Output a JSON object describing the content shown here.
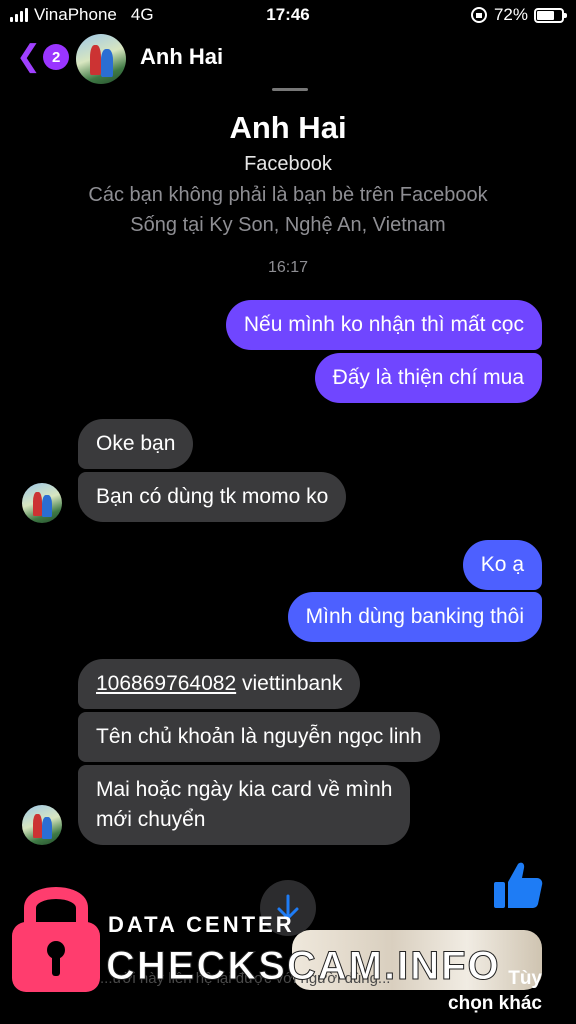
{
  "status_bar": {
    "carrier": "VinaPhone",
    "network": "4G",
    "time": "17:46",
    "battery": "72%",
    "battery_level": 0.72
  },
  "header": {
    "unread_count": "2",
    "contact_name": "Anh Hai"
  },
  "profile": {
    "name": "Anh Hai",
    "source": "Facebook",
    "note": "Các bạn không phải là bạn bè trên Facebook",
    "location": "Sống tại Ky Son, Nghệ An, Vietnam",
    "timestamp": "16:17"
  },
  "messages": [
    {
      "side": "out",
      "text": "Nếu mình ko nhận thì mất cọc"
    },
    {
      "side": "out",
      "text": "Đấy là thiện chí mua"
    },
    {
      "side": "in",
      "text": "Oke bạn"
    },
    {
      "side": "in",
      "text": "Bạn có dùng tk momo ko"
    },
    {
      "side": "out",
      "text": "Ko ạ"
    },
    {
      "side": "out",
      "text": "Mình dùng banking thôi"
    },
    {
      "side": "in",
      "account_number": "106869764082",
      "text": " viettinbank"
    },
    {
      "side": "in",
      "text": "Tên chủ khoản là nguyễn ngọc linh"
    },
    {
      "side": "in",
      "line1": "Mai hoặc ngày kia card về mình",
      "line2": "mới chuyển"
    }
  ],
  "bottom": {
    "faded_text": "...ười này liên hệ lại được với người dùng...",
    "more_options_line1": "Tùy",
    "more_options_line2": "chọn khác"
  },
  "watermark": {
    "line1": "DATA CENTER",
    "line2": "CHECKSCAM.INFO"
  },
  "colors": {
    "background": "#000000",
    "outgoing_bubble": "#6b4cff",
    "incoming_bubble": "#3a3a3c",
    "accent": "#9a35ff",
    "like_icon": "#1e7cf5",
    "watermark_lock": "#ff3d6e"
  },
  "icons": [
    "back-chevron-icon",
    "scroll-down-arrow-icon",
    "thumbs-up-icon",
    "lock-icon"
  ]
}
